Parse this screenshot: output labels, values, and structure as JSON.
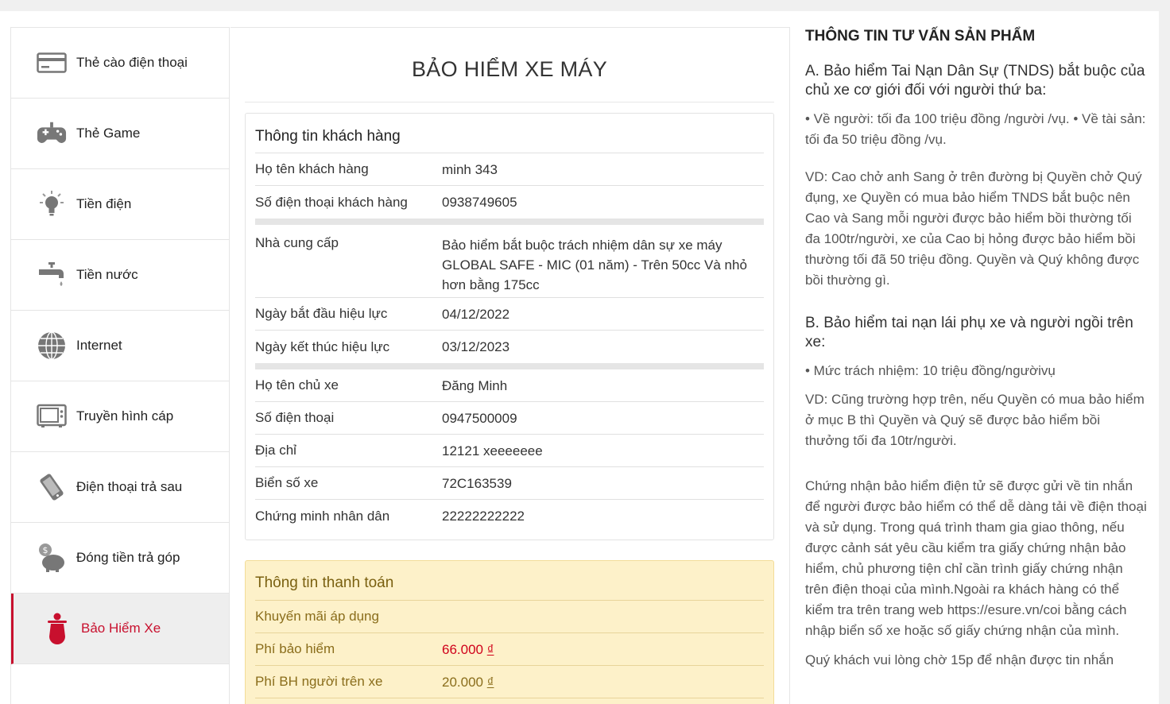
{
  "sidebar": {
    "items": [
      {
        "label": "Thẻ cào điện thoại",
        "icon": "card-icon"
      },
      {
        "label": "Thẻ Game",
        "icon": "gamepad-icon"
      },
      {
        "label": "Tiền điện",
        "icon": "lightbulb-icon"
      },
      {
        "label": "Tiền nước",
        "icon": "faucet-icon"
      },
      {
        "label": "Internet",
        "icon": "globe-icon"
      },
      {
        "label": "Truyền hình cáp",
        "icon": "tv-icon"
      },
      {
        "label": "Điện thoại trả sau",
        "icon": "phone-icon"
      },
      {
        "label": "Đóng tiền trả góp",
        "icon": "piggy-bank-icon"
      },
      {
        "label": "Bảo Hiểm Xe",
        "icon": "scooter-icon",
        "active": true
      }
    ]
  },
  "main": {
    "title": "BẢO HIỂM XE MÁY",
    "customer": {
      "heading": "Thông tin khách hàng",
      "name_label": "Họ tên khách hàng",
      "name": "minh 343",
      "phone_label": "Số điện thoại khách hàng",
      "phone": "0938749605",
      "provider_label": "Nhà cung cấp",
      "provider": "Bảo hiểm bắt buộc trách nhiệm dân sự xe máy GLOBAL SAFE - MIC (01 năm) - Trên 50cc Và nhỏ hơn bằng 175cc",
      "start_label": "Ngày bắt đầu hiệu lực",
      "start": "04/12/2022",
      "end_label": "Ngày kết thúc hiệu lực",
      "end": "03/12/2023",
      "owner_label": "Họ tên chủ xe",
      "owner": "Đăng Minh",
      "owner_phone_label": "Số điện thoại",
      "owner_phone": "0947500009",
      "address_label": "Địa chỉ",
      "address": "12121 xeeeeeee",
      "plate_label": "Biển số xe",
      "plate": "72C163539",
      "id_label": "Chứng minh nhân dân",
      "id": "22222222222"
    },
    "payment": {
      "heading": "Thông tin thanh toán",
      "promo_label": "Khuyến mãi áp dụng",
      "fee_label": "Phí bảo hiểm",
      "fee": "66.000",
      "currency": "₫",
      "passenger_fee_label": "Phí BH người trên xe",
      "passenger_fee": "20.000"
    }
  },
  "info": {
    "title": "THÔNG TIN TƯ VẤN SẢN PHẨM",
    "a_heading": "A. Bảo hiểm Tai Nạn Dân Sự (TNDS) bắt buộc của chủ xe cơ giới đối với người thứ ba:",
    "a_bullets": "•  Về người: tối đa 100 triệu đồng /người /vụ. •  Về tài sản: tối đa 50 triệu đồng /vụ.",
    "a_example": "VD: Cao chở anh Sang ở trên đường bị Quyền chở Quý đụng, xe Quyền có mua bảo hiểm TNDS bắt buộc nên Cao và Sang mỗi người được bảo hiểm bồi thường tối đa 100tr/người, xe của Cao bị hỏng được bảo hiểm bồi thường tối đã 50 triệu đồng. Quyền và Quý không được bồi thường gì.",
    "b_heading": "B. Bảo hiểm tai nạn lái phụ xe và người ngồi trên xe:",
    "b_bullet": "•  Mức trách nhiệm: 10 triệu đồng/ngườivụ",
    "b_example": "VD: Cũng trường hợp trên, nếu Quyền có mua bảo hiểm ở mục B thì Quyền và Quý sẽ được bảo hiểm bồi thưởng tối đa 10tr/người.",
    "certificate": "Chứng nhận bảo hiểm điện tử sẽ được gửi về tin nhắn để người được bảo hiểm có thể dễ dàng tải về điện thoại và sử dụng. Trong quá trình tham gia giao thông, nếu được cảnh sát yêu cầu kiểm tra giấy chứng nhận bảo hiểm, chủ phương tiện chỉ cần trình giấy chứng nhận trên điện thoại của mình.Ngoài ra khách hàng có thể kiểm tra trên trang web https://esure.vn/coi bằng cách nhập biển số xe hoặc số giấy chứng nhận của mình.",
    "wait": "Quý khách vui lòng chờ 15p để nhận được tin nhắn"
  }
}
